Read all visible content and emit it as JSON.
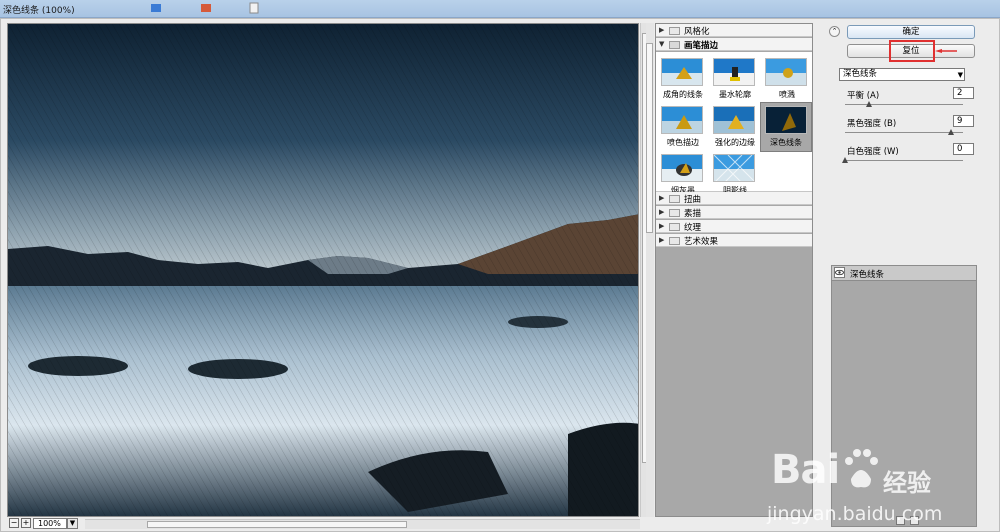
{
  "window": {
    "title": "深色线条 (100%)"
  },
  "preview": {
    "zoom_value": "100%",
    "zoom_out": "−",
    "zoom_in": "+",
    "zoom_dropdown": "▼"
  },
  "gallery": {
    "categories": [
      {
        "label": "风格化",
        "arrow": "▶",
        "open": false
      },
      {
        "label": "画笔描边",
        "arrow": "▼",
        "open": true
      },
      {
        "label": "扭曲",
        "arrow": "▶",
        "open": false
      },
      {
        "label": "素描",
        "arrow": "▶",
        "open": false
      },
      {
        "label": "纹理",
        "arrow": "▶",
        "open": false
      },
      {
        "label": "艺术效果",
        "arrow": "▶",
        "open": false
      }
    ],
    "brush_filters": [
      {
        "label": "成角的线条",
        "selected": false
      },
      {
        "label": "墨水轮廓",
        "selected": false
      },
      {
        "label": "喷溅",
        "selected": false
      },
      {
        "label": "喷色描边",
        "selected": false
      },
      {
        "label": "强化的边缘",
        "selected": false
      },
      {
        "label": "深色线条",
        "selected": true
      },
      {
        "label": "烟灰墨",
        "selected": false
      },
      {
        "label": "阴影线",
        "selected": false
      }
    ]
  },
  "actions": {
    "ok_label": "确定",
    "reset_label": "复位",
    "collapse_icon": "⌃"
  },
  "settings": {
    "filter_select": "深色线条",
    "params": [
      {
        "label": "平衡 (A)",
        "value": "2",
        "slider_fraction": 0.2
      },
      {
        "label": "黑色强度 (B)",
        "value": "9",
        "slider_fraction": 0.9
      },
      {
        "label": "白色强度 (W)",
        "value": "0",
        "slider_fraction": 0.0
      }
    ]
  },
  "layers": {
    "items": [
      {
        "name": "深色线条"
      }
    ]
  },
  "watermark": {
    "brand": "Bai",
    "suffix": "经验",
    "url": "jingyan.baidu.com"
  },
  "colors": {
    "accent_border": "#e03030",
    "panel_gray": "#a8a8a8",
    "button_blue": "#d9e6f4"
  }
}
